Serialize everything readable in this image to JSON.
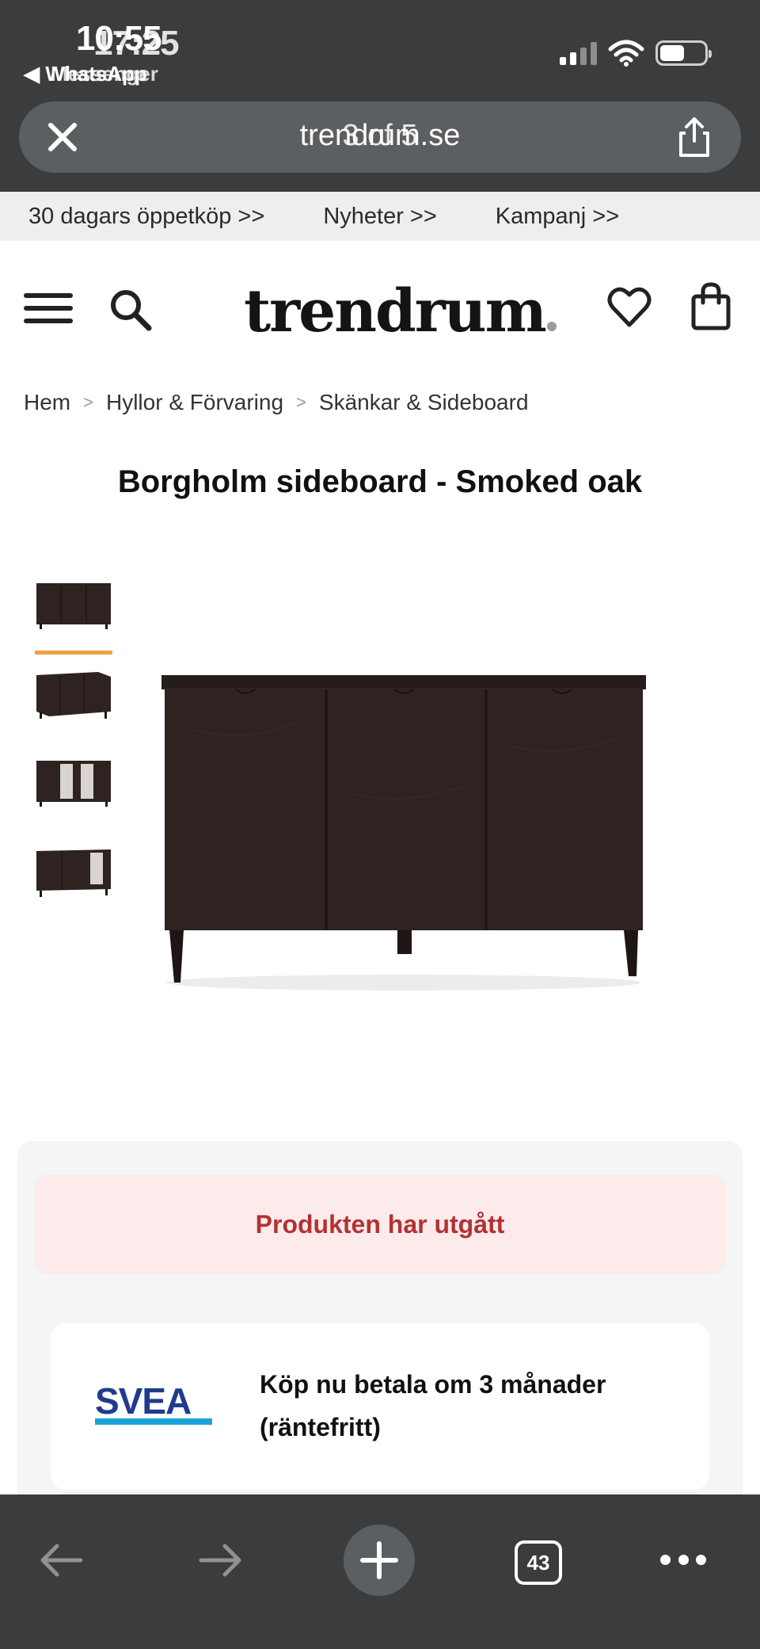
{
  "status_bar": {
    "time": "10:55",
    "time_overlay": "17:25",
    "back_app": "WhatsApp",
    "back_app_overlay": "Messenger"
  },
  "browser": {
    "url": "trendrum.se",
    "url_overlay": "3 of 5",
    "open_tabs": "43"
  },
  "promo": {
    "items": [
      "30 dagars öppetköp >>",
      "Nyheter >>",
      "Kampanj >>"
    ]
  },
  "header": {
    "logo": "trendrum"
  },
  "breadcrumb": {
    "items": [
      "Hem",
      "Hyllor & Förvaring",
      "Skänkar & Sideboard"
    ],
    "separator": ">"
  },
  "product": {
    "title": "Borgholm sideboard - Smoked oak",
    "status": "Produkten har utgått",
    "payment": {
      "brand": "SVEA",
      "text": "Köp nu betala om 3 månader (räntefritt)"
    }
  },
  "colors": {
    "chrome": "#3a3c3e",
    "url_bar": "#5c5f62",
    "accent": "#f0a040",
    "status_bg": "#fcebea",
    "status_text": "#b23234",
    "svea_blue": "#1f3b8c",
    "svea_cyan": "#1aa3d9",
    "wood": "#2e2320"
  }
}
